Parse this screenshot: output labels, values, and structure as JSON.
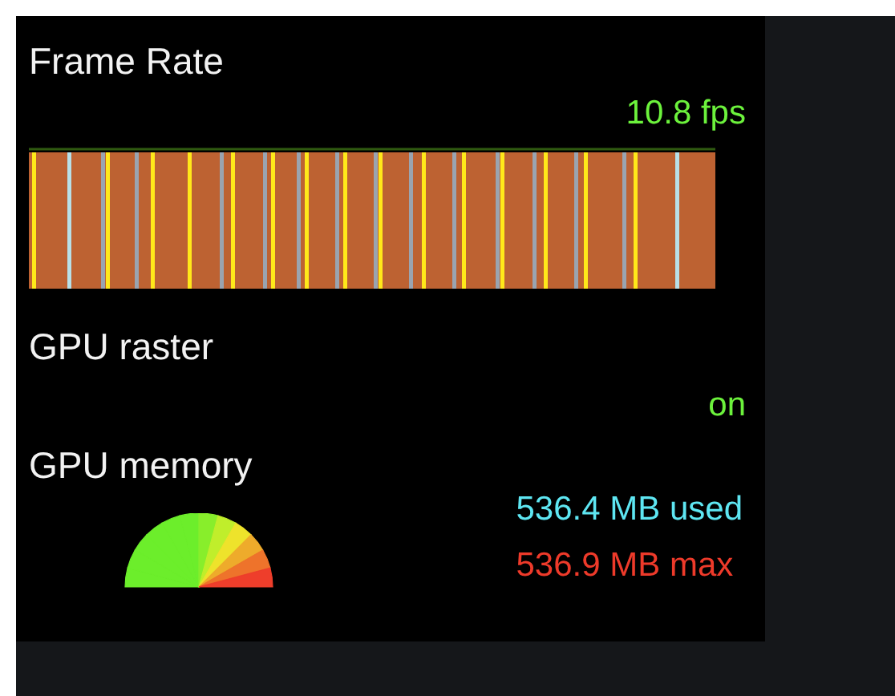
{
  "frame_rate": {
    "title": "Frame Rate",
    "reading": "10.8 fps"
  },
  "gpu_raster": {
    "title": "GPU raster",
    "status": "on"
  },
  "gpu_memory": {
    "title": "GPU memory",
    "used": "536.4 MB used",
    "max": "536.9 MB max"
  }
}
